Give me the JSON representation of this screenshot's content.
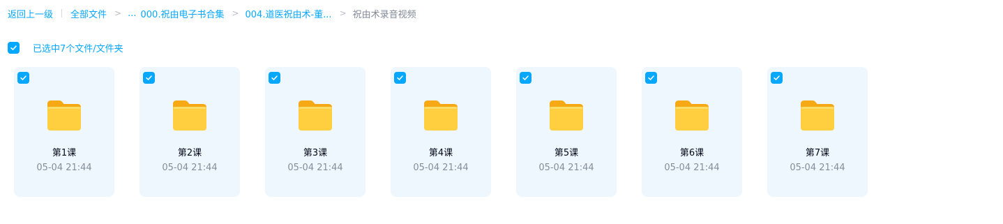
{
  "breadcrumb": {
    "back": "返回上一级",
    "all_files": "全部文件",
    "ellipsis": "...",
    "level1": "000.祝由电子书合集",
    "level2": "004.道医祝由术-董...",
    "current": "祝由术录音视频",
    "separator": ">"
  },
  "selection": {
    "label": "已选中7个文件/文件夹",
    "checked": true
  },
  "colors": {
    "accent": "#06a7ff",
    "card_bg": "#eef7fd",
    "folder": "#ffc933"
  },
  "files": [
    {
      "name": "第1课",
      "time": "05-04 21:44",
      "icon": "folder-icon",
      "checked": true
    },
    {
      "name": "第2课",
      "time": "05-04 21:44",
      "icon": "folder-icon",
      "checked": true
    },
    {
      "name": "第3课",
      "time": "05-04 21:44",
      "icon": "folder-icon",
      "checked": true
    },
    {
      "name": "第4课",
      "time": "05-04 21:44",
      "icon": "folder-icon",
      "checked": true
    },
    {
      "name": "第5课",
      "time": "05-04 21:44",
      "icon": "folder-icon",
      "checked": true
    },
    {
      "name": "第6课",
      "time": "05-04 21:44",
      "icon": "folder-icon",
      "checked": true
    },
    {
      "name": "第7课",
      "time": "05-04 21:44",
      "icon": "folder-icon",
      "checked": true
    }
  ]
}
